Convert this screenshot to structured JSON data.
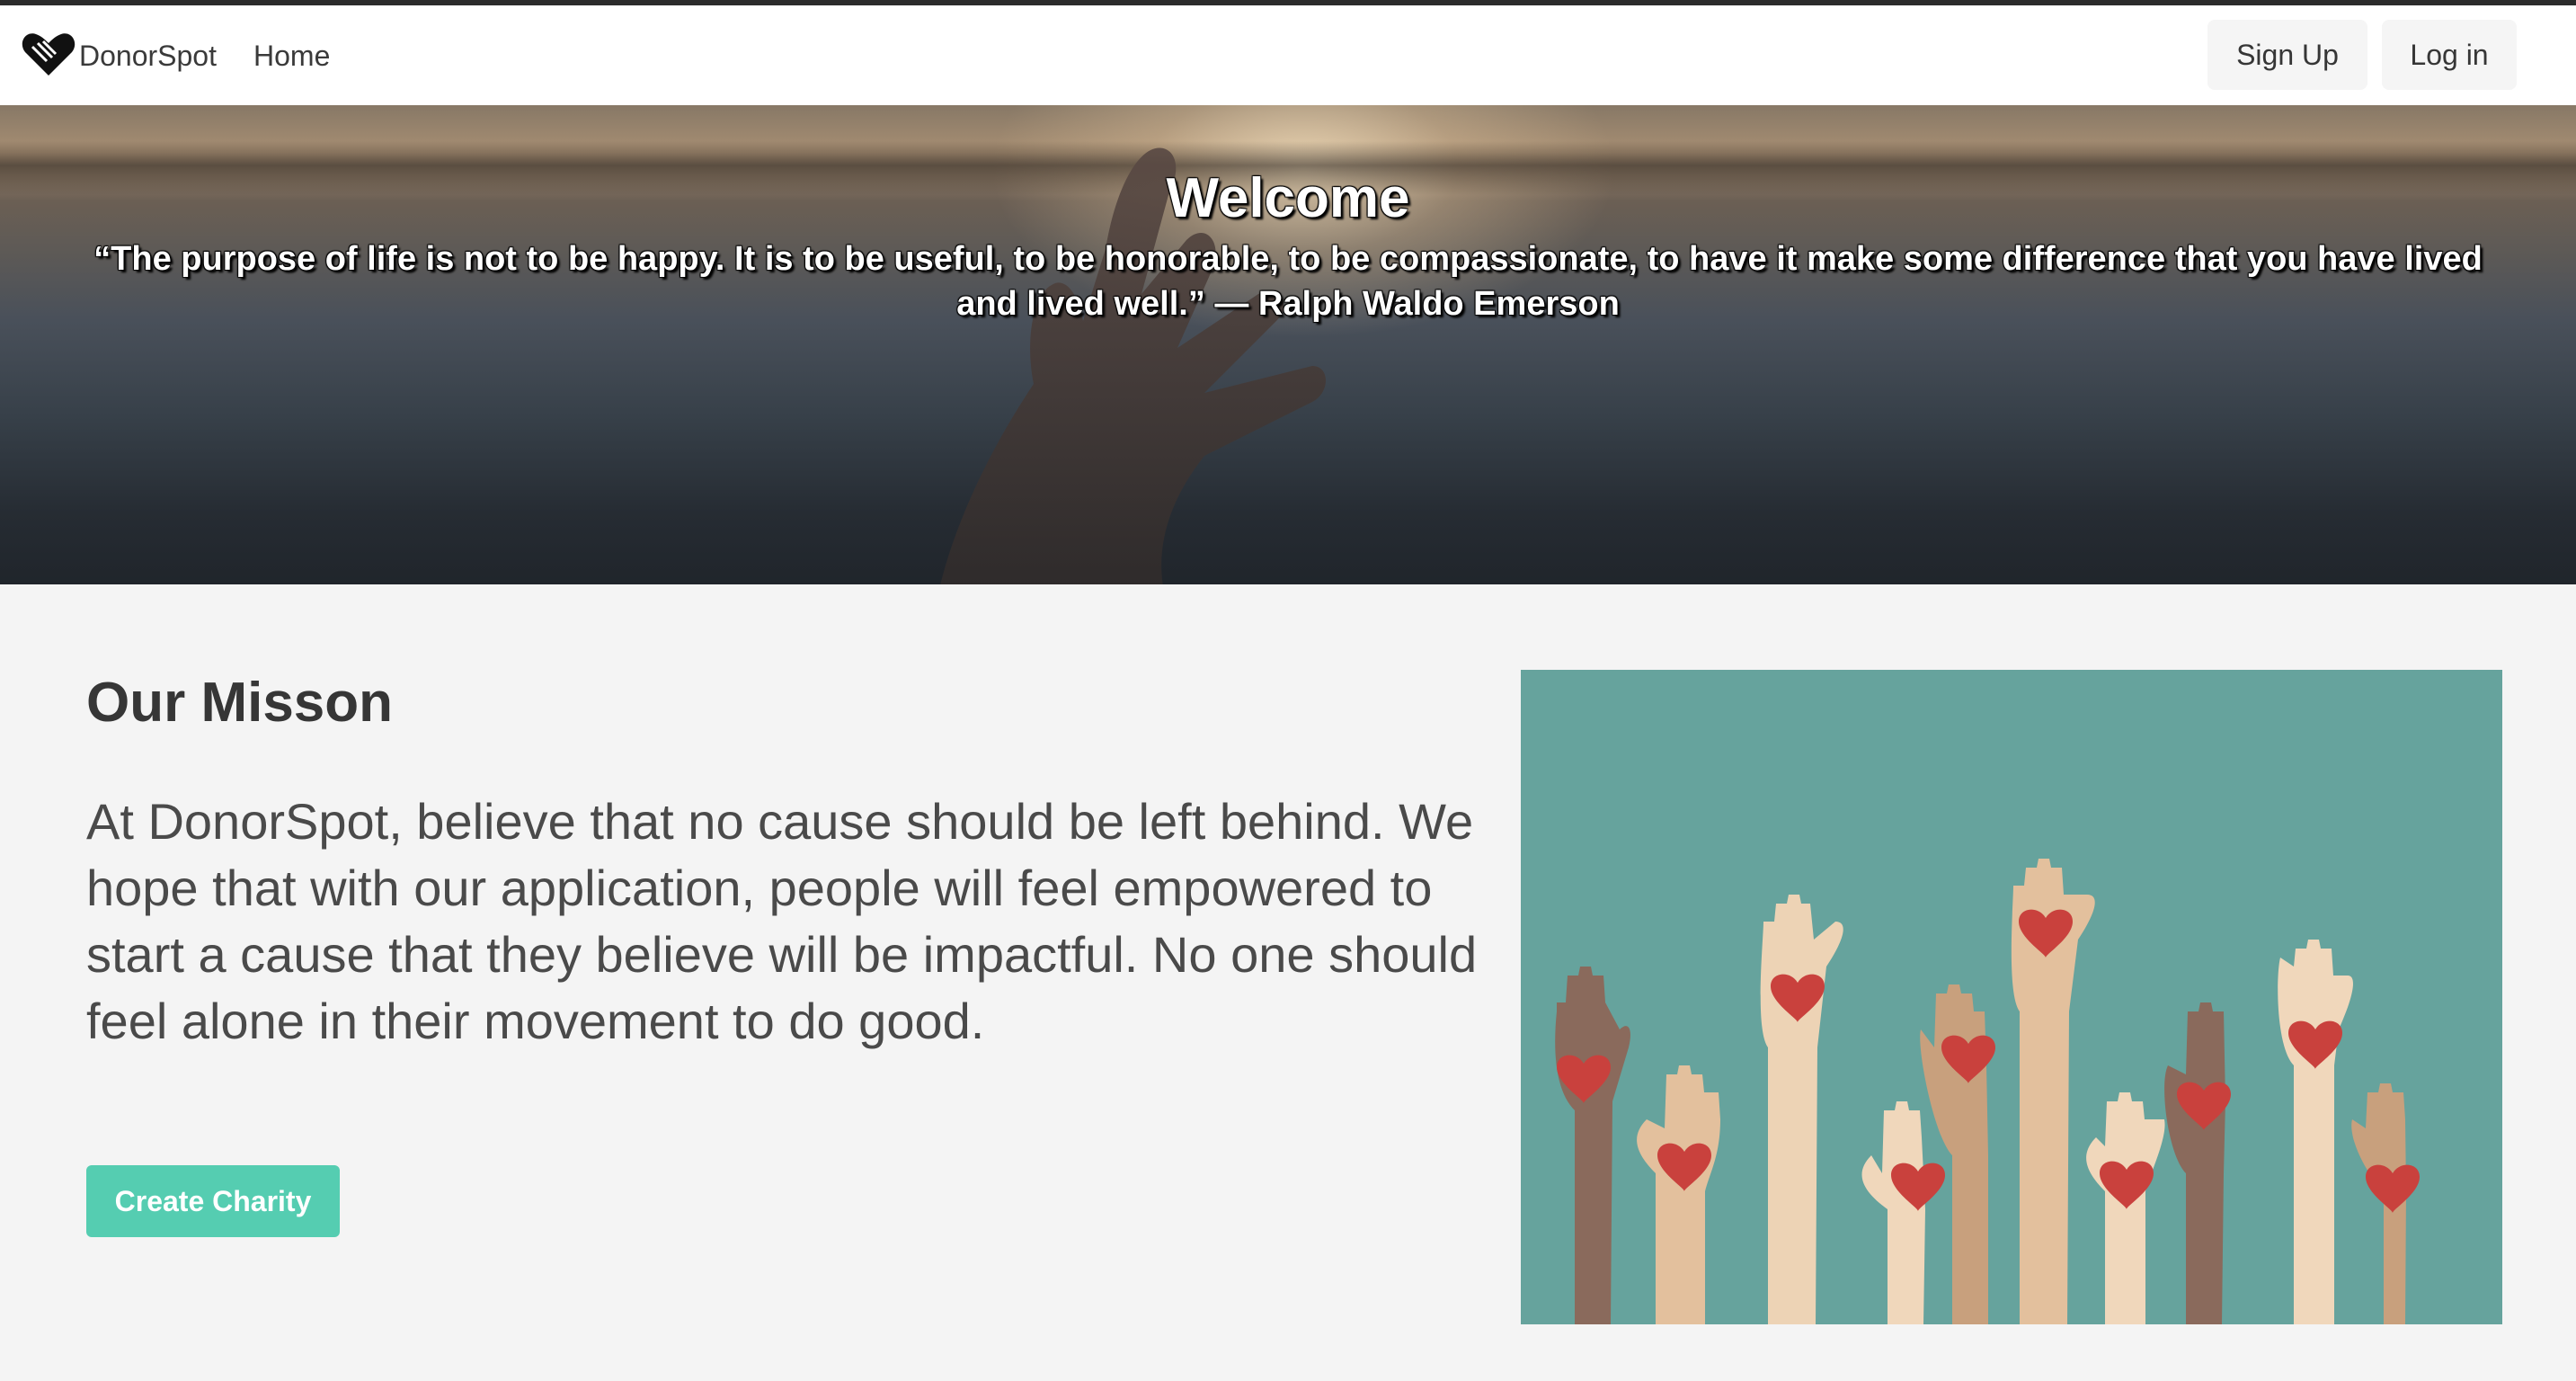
{
  "navbar": {
    "brand_icon": "heart-handshake-icon",
    "brand_name": "DonorSpot",
    "home_label": "Home",
    "signup_label": "Sign Up",
    "login_label": "Log in"
  },
  "hero": {
    "title": "Welcome",
    "quote": "“The purpose of life is not to be happy. It is to be useful, to be honorable, to be compassionate, to have it make some difference that you have lived and lived well.” — Ralph Waldo Emerson"
  },
  "mission": {
    "title": "Our Misson",
    "text": "At DonorSpot, believe that no cause should be left behind. We hope that with our application, people will feel empowered to start a cause that they believe will be impactful. No one should feel alone in their movement to do good.",
    "button_label": "Create Charity",
    "button_color": "#55cdb1",
    "illustration_background": "#66a39d"
  }
}
